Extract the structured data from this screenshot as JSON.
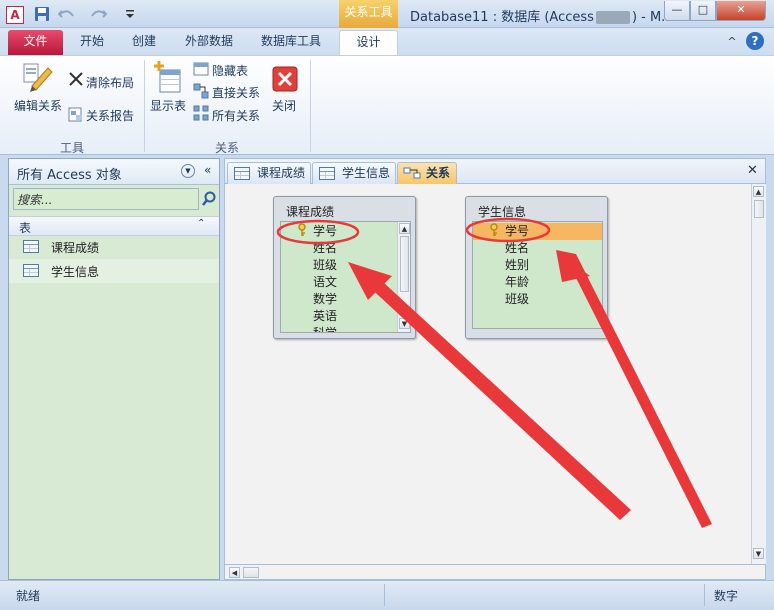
{
  "window": {
    "title": "Database11 : 数据库 (Access",
    "title_suffix": ") - M...",
    "contextual_tab": "关系工具",
    "min_symbol": "—",
    "max_symbol": "□",
    "close_symbol": "✕"
  },
  "tabs": {
    "file": "文件",
    "home": "开始",
    "create": "创建",
    "external": "外部数据",
    "dbtools": "数据库工具",
    "design": "设计",
    "collapse": "^",
    "help": "?"
  },
  "ribbon": {
    "tools_group": "工具",
    "edit_relations": "编辑关系",
    "clear_layout": "清除布局",
    "relation_report": "关系报告",
    "relations_group": "关系",
    "show_table": "显示表",
    "hide_table": "隐藏表",
    "direct_relations": "直接关系",
    "all_relations": "所有关系",
    "close": "关闭"
  },
  "nav": {
    "header": "所有 Access 对象",
    "search_placeholder": "搜索...",
    "group": "表",
    "items": [
      "课程成绩",
      "学生信息"
    ]
  },
  "doc_tabs": [
    "课程成绩",
    "学生信息",
    "关系"
  ],
  "tables": [
    {
      "name": "课程成绩",
      "fields": [
        "学号",
        "姓名",
        "班级",
        "语文",
        "数学",
        "英语",
        "科学"
      ]
    },
    {
      "name": "学生信息",
      "fields": [
        "学号",
        "姓名",
        "姓别",
        "年龄",
        "班级"
      ]
    }
  ],
  "status": {
    "left": "就绪",
    "right": "数字"
  },
  "colors": {
    "annotation": "#e8383a",
    "selected_field": "#f7b661",
    "file_tab": "#c9203f"
  }
}
